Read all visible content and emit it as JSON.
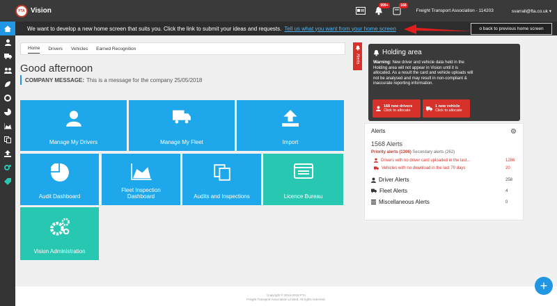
{
  "app": {
    "title": "Vision",
    "logo_text": "FTA"
  },
  "topbar": {
    "notifications_badge": "999+",
    "messages_badge": "168",
    "org": "Freight Transport Association - 114203",
    "user": "svarrall@fta.co.uk ▾"
  },
  "banner": {
    "text": "We want to develop a new home screen that suits you. Click the link to submit your ideas and requests.",
    "link": "Tell us what you want from your home screen",
    "back_button": "o back to previous home screen"
  },
  "tabs": [
    "Home",
    "Drivers",
    "Vehicles",
    "Earned Recognition"
  ],
  "alerts_tab_label": "Alerts",
  "greeting": "Good afternoon",
  "company_message": {
    "label": "COMPANY MESSAGE:",
    "text": "This is a message for the company 25/05/2018"
  },
  "tiles": [
    {
      "label": "Manage My Drivers",
      "icon": "user-icon"
    },
    {
      "label": "Manage My Fleet",
      "icon": "truck-icon"
    },
    {
      "label": "Import",
      "icon": "upload-icon"
    },
    {
      "label": "Audit Dashboard",
      "icon": "pie-chart-icon"
    },
    {
      "label": "Fleet Inspection Dashboard",
      "icon": "area-chart-icon"
    },
    {
      "label": "Audits and Inspections",
      "icon": "copy-icon"
    },
    {
      "label": "Licence Bureau",
      "icon": "id-card-icon"
    },
    {
      "label": "Vision Administration",
      "icon": "gears-icon"
    }
  ],
  "holding_area": {
    "title": "Holding area",
    "warning_label": "Warning:",
    "warning": "New driver and vehicle data held in the Holding area will not appear in Vision until it is allocated. As a result the card and vehicle uploads will not be analysed and may result in non-compliant & inaccurate reporting information.",
    "drivers_btn": {
      "line1": "168 new drivers",
      "line2": "Click to allocate"
    },
    "vehicles_btn": {
      "line1": "1 new vehicle",
      "line2": "Click to allocate"
    }
  },
  "alerts": {
    "title": "Alerts",
    "total": "1568 Alerts",
    "priority_label": "Priority alerts (1306)",
    "secondary_label": "Secondary alerts (262)",
    "priority_items": [
      {
        "text": "Drivers with no driver card uploaded in the last...",
        "count": "1286"
      },
      {
        "text": "Vehicles with no download in the last 70 days",
        "count": "20"
      }
    ],
    "categories": [
      {
        "label": "Driver Alerts",
        "count": "258"
      },
      {
        "label": "Fleet Alerts",
        "count": "4"
      },
      {
        "label": "Miscellaneous Alerts",
        "count": "0"
      }
    ]
  },
  "footer": {
    "line1": "Copyright © 2014-2018 FTA",
    "line2": "Freight Transport Association Limited. All rights reserved."
  },
  "colors": {
    "accent": "#1ea7ea",
    "teal": "#27c7b2",
    "alert_red": "#d6322b",
    "dark": "#3a3a3a"
  }
}
